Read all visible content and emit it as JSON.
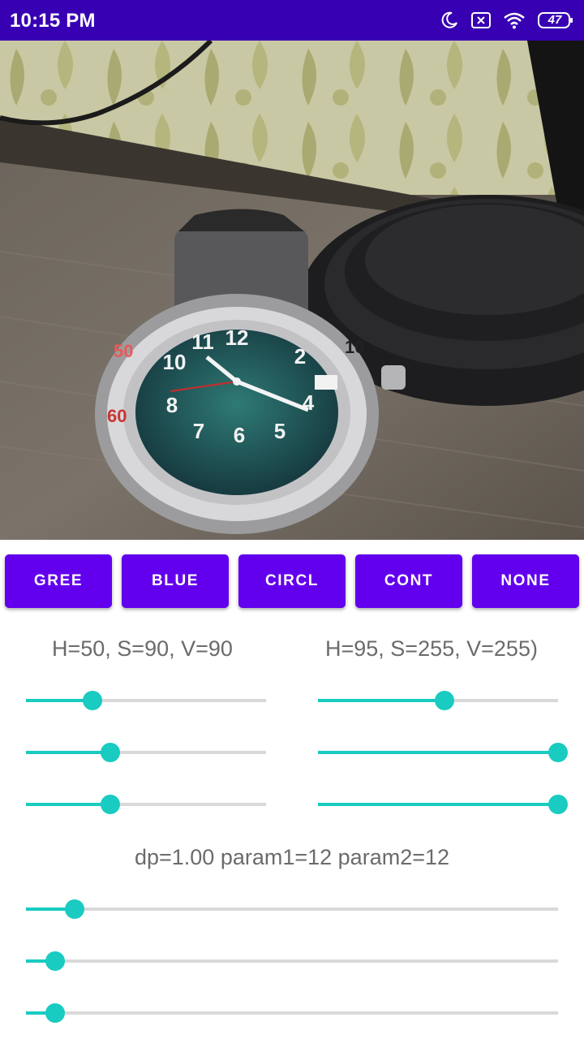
{
  "status_bar": {
    "time": "10:15 PM",
    "battery": "47",
    "icons": [
      "moon-icon",
      "sim-off-icon",
      "wifi-icon",
      "battery-icon"
    ]
  },
  "camera": {
    "description_icon": "camera-preview"
  },
  "buttons": [
    {
      "id": "gree",
      "label": "GREE"
    },
    {
      "id": "blue",
      "label": "BLUE"
    },
    {
      "id": "circl",
      "label": "CIRCL"
    },
    {
      "id": "cont",
      "label": "CONT"
    },
    {
      "id": "none",
      "label": "NONE"
    }
  ],
  "hsv": {
    "lower_label": "H=50, S=90, V=90",
    "upper_label": "H=95, S=255, V=255)",
    "lower_sliders": [
      {
        "name": "lower-h-slider",
        "fraction": 0.277
      },
      {
        "name": "lower-s-slider",
        "fraction": 0.351
      },
      {
        "name": "lower-v-slider",
        "fraction": 0.351
      }
    ],
    "upper_sliders": [
      {
        "name": "upper-h-slider",
        "fraction": 0.527
      },
      {
        "name": "upper-s-slider",
        "fraction": 1.0
      },
      {
        "name": "upper-v-slider",
        "fraction": 1.0
      }
    ]
  },
  "hough": {
    "label": "dp=1.00 param1=12 param2=12",
    "sliders": [
      {
        "name": "dp-slider",
        "fraction": 0.091
      },
      {
        "name": "param1-slider",
        "fraction": 0.055
      },
      {
        "name": "param2-slider",
        "fraction": 0.055
      }
    ]
  },
  "colors": {
    "status_bar": "#3700b3",
    "button": "#6200ee",
    "accent": "#19cbc1",
    "track": "#d9d9d9"
  }
}
